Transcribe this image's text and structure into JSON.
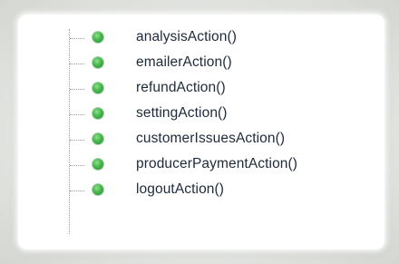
{
  "tree": {
    "items": [
      {
        "label": "analysisAction()",
        "icon": "green-circle-icon",
        "icon_color": "#45b84a"
      },
      {
        "label": "emailerAction()",
        "icon": "green-circle-icon",
        "icon_color": "#45b84a"
      },
      {
        "label": "refundAction()",
        "icon": "green-circle-icon",
        "icon_color": "#45b84a"
      },
      {
        "label": "settingAction()",
        "icon": "green-circle-icon",
        "icon_color": "#45b84a"
      },
      {
        "label": "customerIssuesAction()",
        "icon": "green-circle-icon",
        "icon_color": "#45b84a"
      },
      {
        "label": "producerPaymentAction()",
        "icon": "green-circle-icon",
        "icon_color": "#45b84a"
      },
      {
        "label": "logoutAction()",
        "icon": "green-circle-icon",
        "icon_color": "#45b84a"
      }
    ]
  }
}
